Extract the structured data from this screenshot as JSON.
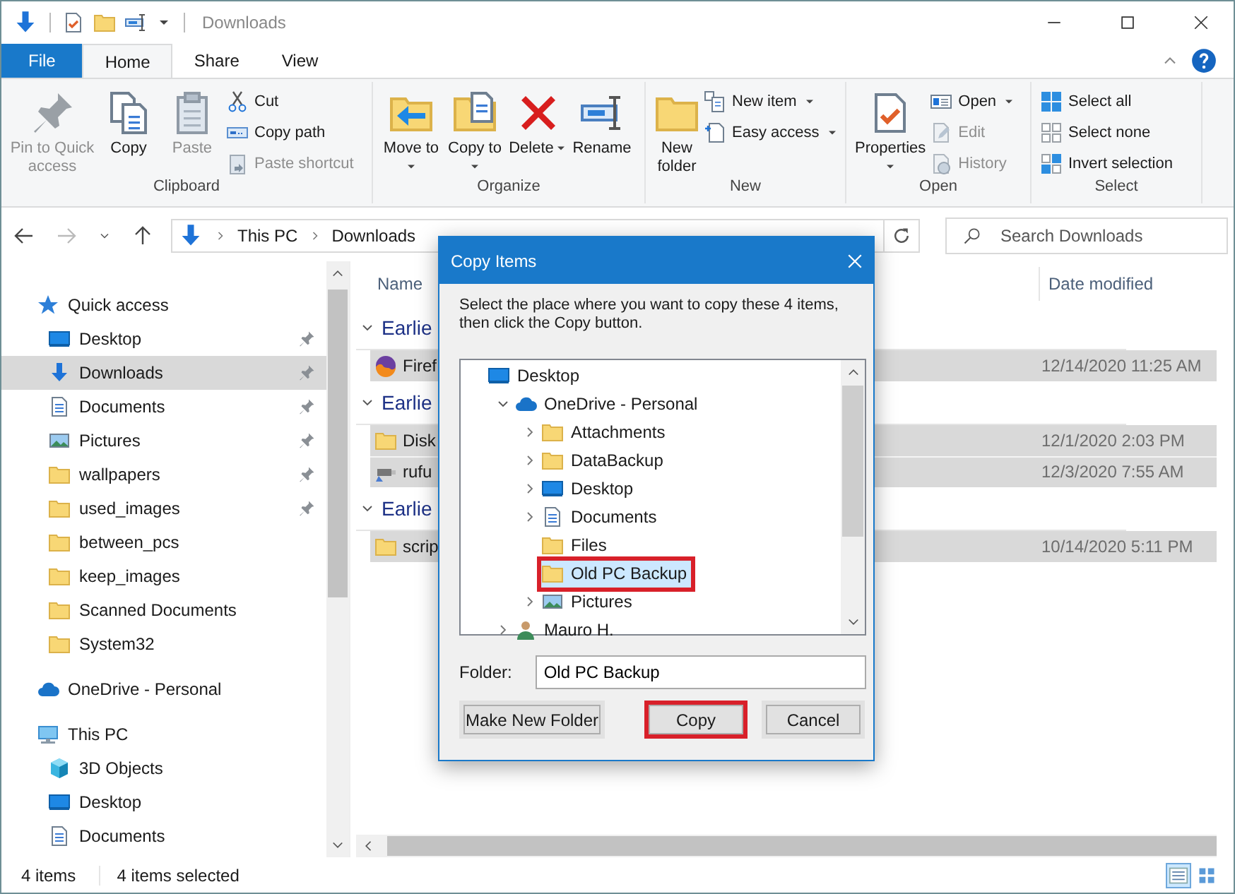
{
  "window": {
    "title": "Downloads"
  },
  "ribbon_tabs": [
    {
      "label": "File",
      "kind": "file",
      "selected": false
    },
    {
      "label": "Home",
      "kind": "tab",
      "selected": true
    },
    {
      "label": "Share",
      "kind": "tab",
      "selected": false
    },
    {
      "label": "View",
      "kind": "tab",
      "selected": false
    }
  ],
  "ribbon": {
    "groups": [
      {
        "label": "Clipboard",
        "large": [
          {
            "kind": "pin",
            "label": "Pin to Quick access",
            "disabled": true,
            "menu": false
          },
          {
            "kind": "copy",
            "label": "Copy",
            "disabled": false,
            "menu": false
          },
          {
            "kind": "paste",
            "label": "Paste",
            "disabled": true,
            "menu": false
          }
        ],
        "small": [
          {
            "kind": "cut",
            "label": "Cut",
            "disabled": false,
            "menu": false
          },
          {
            "kind": "path",
            "label": "Copy path",
            "disabled": false,
            "menu": false
          },
          {
            "kind": "shortcut",
            "label": "Paste shortcut",
            "disabled": true,
            "menu": false
          }
        ]
      },
      {
        "label": "Organize",
        "large": [
          {
            "kind": "move",
            "label": "Move to",
            "disabled": false,
            "menu": true
          },
          {
            "kind": "copyto",
            "label": "Copy to",
            "disabled": false,
            "menu": true
          },
          {
            "kind": "delete",
            "label": "Delete",
            "disabled": false,
            "menu": true
          },
          {
            "kind": "rename",
            "label": "Rename",
            "disabled": false,
            "menu": false
          }
        ]
      },
      {
        "label": "New",
        "large": [
          {
            "kind": "newfolder",
            "label": "New folder",
            "disabled": false,
            "menu": false
          }
        ],
        "small": [
          {
            "kind": "newitem",
            "label": "New item",
            "disabled": false,
            "menu": true
          },
          {
            "kind": "easyaccess",
            "label": "Easy access",
            "disabled": false,
            "menu": true
          }
        ]
      },
      {
        "label": "Open",
        "large": [
          {
            "kind": "properties",
            "label": "Properties",
            "disabled": false,
            "menu": true
          }
        ],
        "small": [
          {
            "kind": "open",
            "label": "Open",
            "disabled": false,
            "menu": true
          },
          {
            "kind": "edit",
            "label": "Edit",
            "disabled": true,
            "menu": false
          },
          {
            "kind": "history",
            "label": "History",
            "disabled": true,
            "menu": false
          }
        ]
      },
      {
        "label": "Select",
        "small": [
          {
            "kind": "selectall",
            "label": "Select all",
            "disabled": false,
            "menu": false
          },
          {
            "kind": "selectnone",
            "label": "Select none",
            "disabled": false,
            "menu": false
          },
          {
            "kind": "invert",
            "label": "Invert selection",
            "disabled": false,
            "menu": false
          }
        ]
      }
    ]
  },
  "address": {
    "breadcrumb": [
      "This PC",
      "Downloads"
    ],
    "search": {
      "placeholder": "Search Downloads"
    }
  },
  "nav": [
    {
      "kind": "star",
      "label": "Quick access",
      "selected": false,
      "children": [
        {
          "kind": "desktop",
          "label": "Desktop",
          "pinned": true,
          "selected": false
        },
        {
          "kind": "download",
          "label": "Downloads",
          "pinned": true,
          "selected": true
        },
        {
          "kind": "document",
          "label": "Documents",
          "pinned": true,
          "selected": false
        },
        {
          "kind": "picture",
          "label": "Pictures",
          "pinned": true,
          "selected": false
        },
        {
          "kind": "folder",
          "label": "wallpapers",
          "pinned": true,
          "selected": false
        },
        {
          "kind": "folder",
          "label": "used_images",
          "pinned": true,
          "selected": false
        },
        {
          "kind": "folder",
          "label": "between_pcs",
          "pinned": false,
          "selected": false
        },
        {
          "kind": "folder",
          "label": "keep_images",
          "pinned": false,
          "selected": false
        },
        {
          "kind": "folder",
          "label": "Scanned Documents",
          "pinned": false,
          "selected": false
        },
        {
          "kind": "folder",
          "label": "System32",
          "pinned": false,
          "selected": false
        }
      ]
    },
    {
      "kind": "cloud",
      "label": "OneDrive - Personal",
      "selected": false
    },
    {
      "kind": "pc",
      "label": "This PC",
      "selected": false,
      "children": [
        {
          "kind": "cube",
          "label": "3D Objects",
          "pinned": false,
          "selected": false
        },
        {
          "kind": "desktop",
          "label": "Desktop",
          "pinned": false,
          "selected": false
        },
        {
          "kind": "document",
          "label": "Documents",
          "pinned": false,
          "selected": false
        }
      ]
    }
  ],
  "file_list": {
    "columns": [
      "Name",
      "Date modified"
    ],
    "groups": [
      {
        "label": "Earlie",
        "files": [
          {
            "kind": "app",
            "name": "Firef",
            "date": "12/14/2020 11:25 AM",
            "selected": true
          }
        ]
      },
      {
        "label": "Earlie",
        "files": [
          {
            "kind": "folder",
            "name": "Disk",
            "date": "12/1/2020 2:03 PM",
            "selected": true
          },
          {
            "kind": "usb",
            "name": "rufu",
            "date": "12/3/2020 7:55 AM",
            "selected": true
          }
        ]
      },
      {
        "label": "Earlie",
        "files": [
          {
            "kind": "folder",
            "name": "scrip",
            "date": "10/14/2020 5:11 PM",
            "selected": true
          }
        ]
      }
    ]
  },
  "status_bar": {
    "count": "4 items",
    "selection": "4 items selected"
  },
  "dialog": {
    "title": "Copy Items",
    "instruction": "Select the place where you want to copy these 4 items, then click the Copy button.",
    "tree": [
      {
        "kind": "desktop",
        "label": "Desktop",
        "selected": false,
        "highlighted": false,
        "children": [
          {
            "kind": "cloud",
            "label": "OneDrive - Personal",
            "expanded": true,
            "selected": false,
            "highlighted": false,
            "children": [
              {
                "kind": "folder",
                "label": "Attachments",
                "expanded": false,
                "selected": false,
                "highlighted": false
              },
              {
                "kind": "folder",
                "label": "DataBackup",
                "expanded": false,
                "selected": false,
                "highlighted": false
              },
              {
                "kind": "desktop",
                "label": "Desktop",
                "expanded": false,
                "selected": false,
                "highlighted": false
              },
              {
                "kind": "document",
                "label": "Documents",
                "expanded": false,
                "selected": false,
                "highlighted": false
              },
              {
                "kind": "folder",
                "label": "Files",
                "selected": false,
                "highlighted": false
              },
              {
                "kind": "folder",
                "label": "Old PC Backup",
                "selected": true,
                "highlighted": true
              },
              {
                "kind": "picture",
                "label": "Pictures",
                "expanded": false,
                "selected": false,
                "highlighted": false
              }
            ]
          },
          {
            "kind": "person",
            "label": "Mauro H.",
            "expanded": false,
            "selected": false,
            "highlighted": false
          }
        ]
      }
    ],
    "folder": {
      "label": "Folder:",
      "value": "Old PC Backup"
    },
    "buttons": [
      {
        "label": "Make New Folder",
        "highlighted": false
      },
      {
        "label": "Copy",
        "highlighted": true
      },
      {
        "label": "Cancel",
        "highlighted": false
      }
    ]
  }
}
